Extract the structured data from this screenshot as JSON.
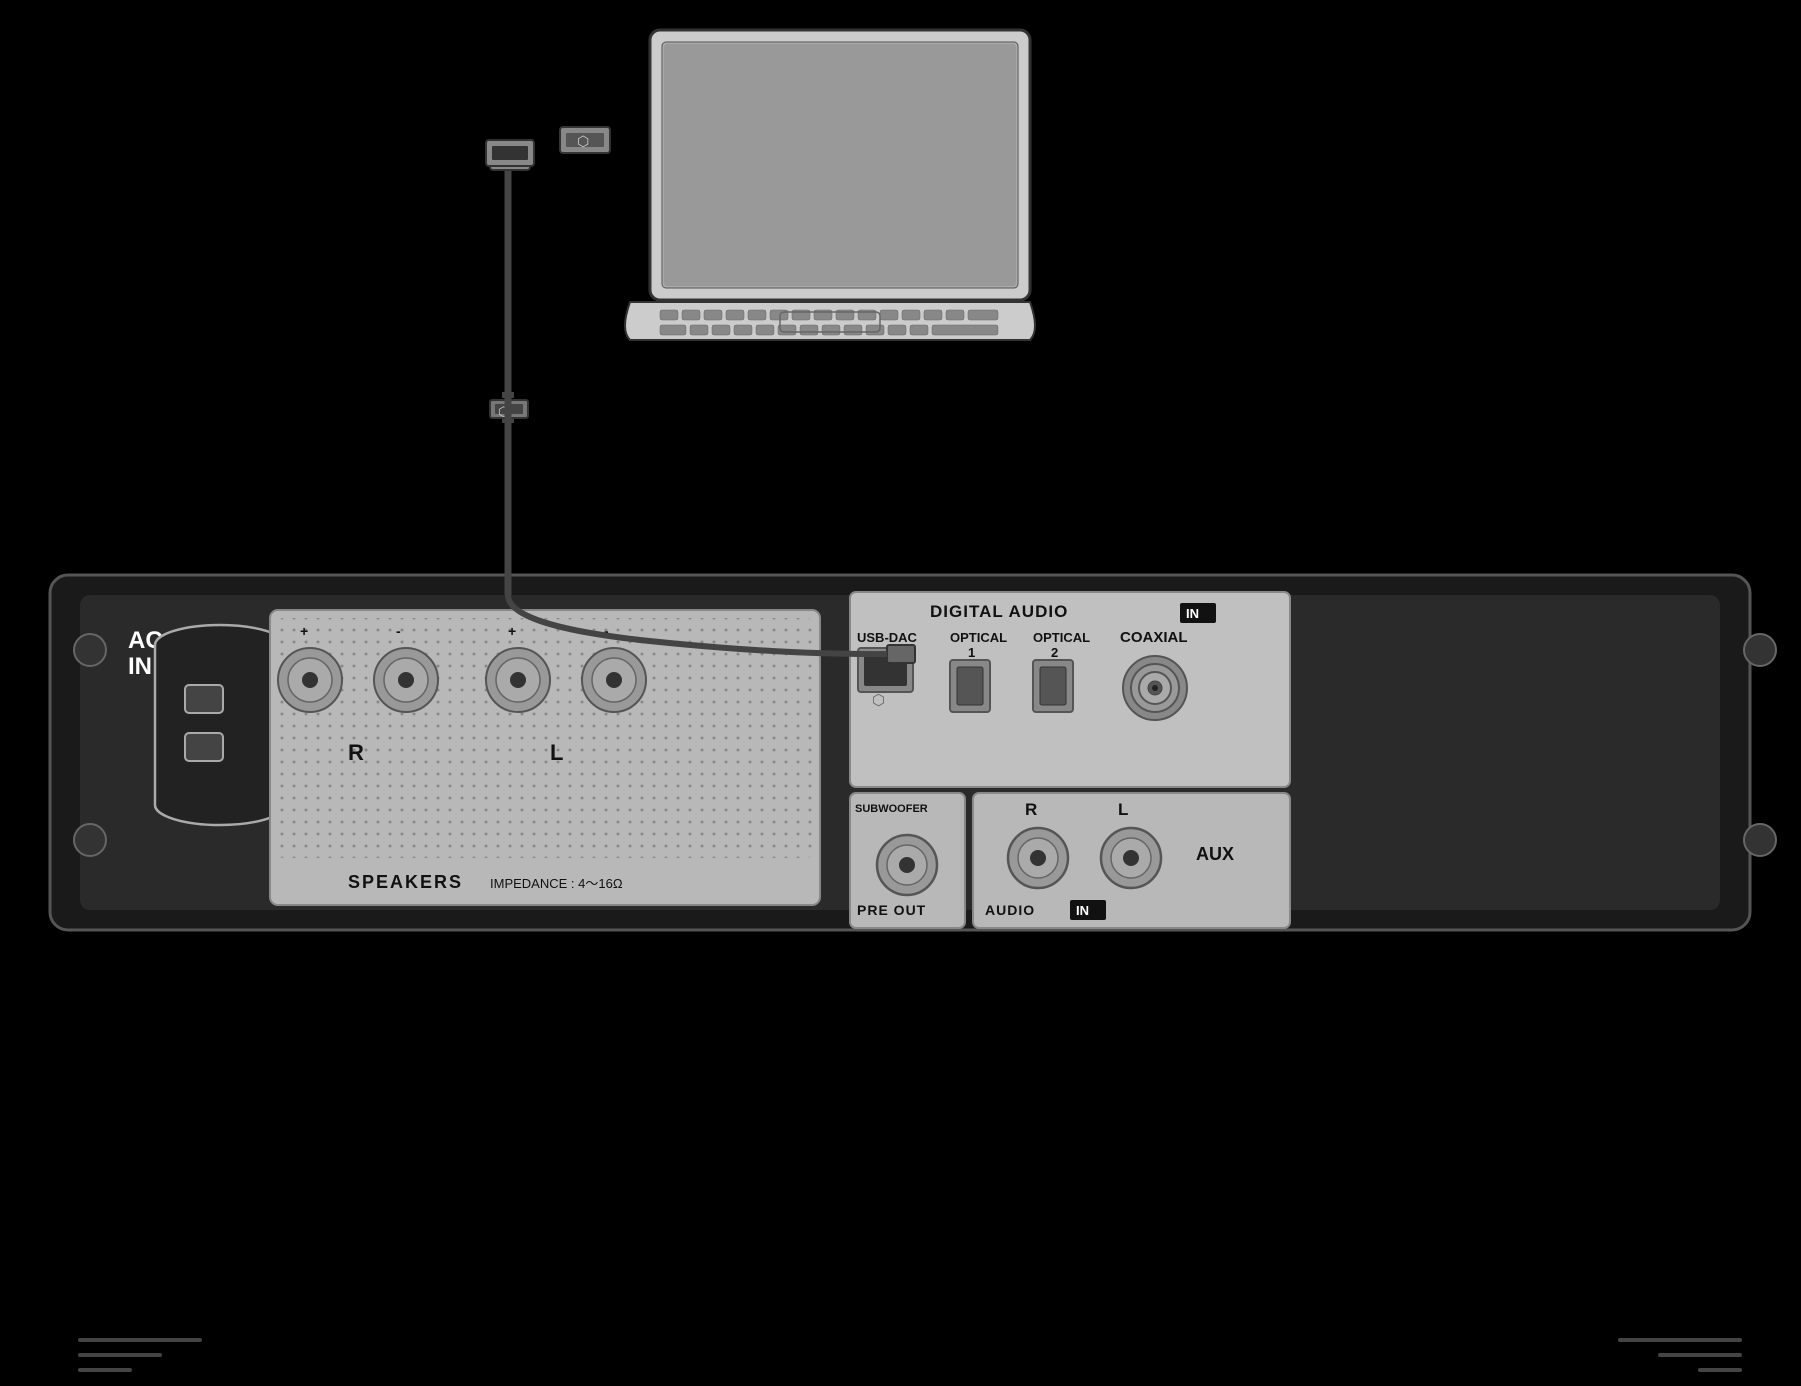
{
  "scene": {
    "background": "#000000"
  },
  "labels": {
    "ac_in": "AC\nIN",
    "ac_in_line1": "AC",
    "ac_in_line2": "IN",
    "speakers": "SPEAKERS",
    "impedance": "IMPEDANCE : 4～16Ω",
    "channel_r": "R",
    "channel_l": "L",
    "channel_plus1": "+",
    "channel_minus1": "-",
    "channel_plus2": "+",
    "channel_minus2": "-",
    "digital_audio": "DIGITAL AUDIO",
    "in_badge": "IN",
    "usb_dac": "USB-DAC",
    "optical_1": "OPTICAL\n1",
    "optical_1_line1": "OPTICAL",
    "optical_1_line2": "1",
    "optical_2": "OPTICAL\n2",
    "optical_2_line1": "OPTICAL",
    "optical_2_line2": "2",
    "coaxial": "COAXIAL",
    "sub_woofer": "SUBWOOFER",
    "pre_out": "PRE OUT",
    "audio": "AUDIO",
    "audio_in_badge": "IN",
    "channel_r_audio": "R",
    "channel_l_audio": "L",
    "aux": "AUX",
    "usb_symbol": "⬡"
  },
  "colors": {
    "panel_bg": "#2a2a2a",
    "section_bg": "#b8b8b8",
    "digital_bg": "#c0c0c0",
    "text_dark": "#111111",
    "text_white": "#ffffff",
    "connector_bg": "#888888",
    "knob_gradient_light": "#d0d0d0",
    "knob_gradient_dark": "#888888",
    "badge_bg": "#111111",
    "badge_text": "#ffffff"
  }
}
